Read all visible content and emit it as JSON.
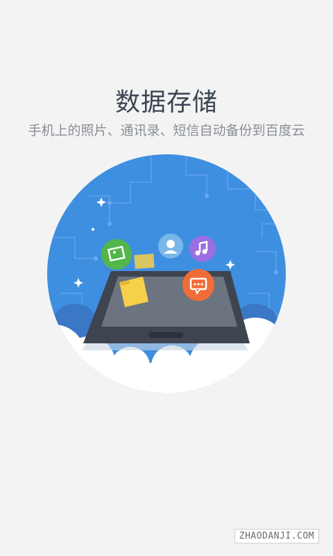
{
  "title": "数据存储",
  "subtitle": "手机上的照片、通讯录、短信自动备份到百度云",
  "watermark": "ZHAODANJI.COM",
  "illustration": {
    "bubbles": [
      {
        "name": "photo-icon",
        "color": "#52b64a"
      },
      {
        "name": "contacts-icon",
        "color": "#78b7e8"
      },
      {
        "name": "music-icon",
        "color": "#9b6ee3"
      },
      {
        "name": "message-icon",
        "color": "#f06d39"
      }
    ],
    "background_color": "#3f8fe0",
    "cloud_color": "#ffffff",
    "phone_color": "#3e4450"
  }
}
